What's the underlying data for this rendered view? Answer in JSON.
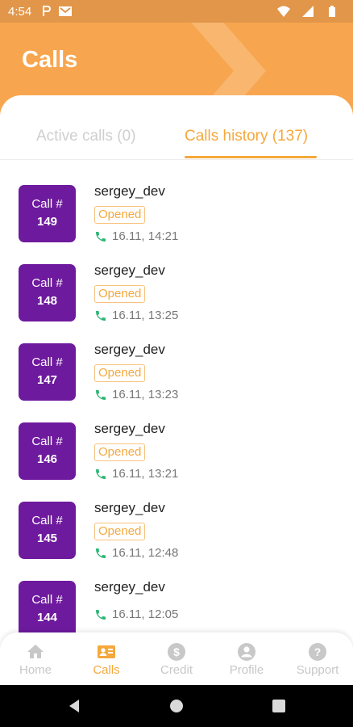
{
  "status_bar": {
    "time": "4:54"
  },
  "header": {
    "title": "Calls"
  },
  "tabs": [
    {
      "label": "Active calls (0)",
      "active": false
    },
    {
      "label": "Calls history (137)",
      "active": true
    }
  ],
  "calls": [
    {
      "line1": "Call #",
      "number": "149",
      "user": "sergey_dev",
      "status": "Opened",
      "time": "16.11, 14:21"
    },
    {
      "line1": "Call #",
      "number": "148",
      "user": "sergey_dev",
      "status": "Opened",
      "time": "16.11, 13:25"
    },
    {
      "line1": "Call #",
      "number": "147",
      "user": "sergey_dev",
      "status": "Opened",
      "time": "16.11, 13:23"
    },
    {
      "line1": "Call #",
      "number": "146",
      "user": "sergey_dev",
      "status": "Opened",
      "time": "16.11, 13:21"
    },
    {
      "line1": "Call #",
      "number": "145",
      "user": "sergey_dev",
      "status": "Opened",
      "time": "16.11, 12:48"
    },
    {
      "line1": "Call #",
      "number": "144",
      "user": "sergey_dev",
      "status": "",
      "time": "16.11, 12:05"
    }
  ],
  "bottom_nav": [
    {
      "label": "Home",
      "icon": "home-icon",
      "active": false
    },
    {
      "label": "Calls",
      "icon": "contact-card-icon",
      "active": true
    },
    {
      "label": "Credit",
      "icon": "dollar-icon",
      "active": false
    },
    {
      "label": "Profile",
      "icon": "profile-icon",
      "active": false
    },
    {
      "label": "Support",
      "icon": "help-icon",
      "active": false
    }
  ],
  "colors": {
    "header": "#f7a64f",
    "accent": "#f5a83c",
    "badge": "#6e1a9e",
    "call_icon": "#2bb673"
  }
}
